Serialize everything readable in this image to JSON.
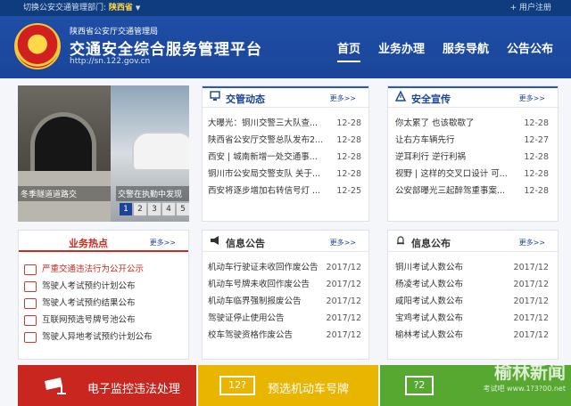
{
  "topbar": {
    "switch_label": "切换公安交通管理部门:",
    "province": "陕西省",
    "register": "用户注册"
  },
  "header": {
    "org": "陕西省公安厅交通管理局",
    "title": "交通安全综合服务管理平台",
    "url": "http://sn.122.gov.cn"
  },
  "nav": [
    "首页",
    "业务办理",
    "服务导航",
    "公告公布"
  ],
  "slider": {
    "caption1": "冬季隧道道路交",
    "caption2": "交警在执勤中发现",
    "pages": [
      "1",
      "2",
      "3",
      "4",
      "5"
    ]
  },
  "news": {
    "title": "交管动态",
    "more": "更多>>",
    "items": [
      {
        "t": "大曝光：铜川交警三大队查...",
        "d": "12-28"
      },
      {
        "t": "陕西省公安厅交警总队发布2...",
        "d": "12-28"
      },
      {
        "t": "西安 | 城南新增一处交通事...",
        "d": "12-28"
      },
      {
        "t": "铜川市公安局交警支队 关于...",
        "d": "12-28"
      },
      {
        "t": "西安将逐步增加右转信号灯 ...",
        "d": "12-25"
      }
    ]
  },
  "safety": {
    "title": "安全宣传",
    "more": "更多>>",
    "items": [
      {
        "t": "你太累了 也该歇歇了",
        "d": "12-28"
      },
      {
        "t": "让右方车辆先行",
        "d": "12-27"
      },
      {
        "t": "逆耳利行 逆行利祸",
        "d": "12-28"
      },
      {
        "t": "视野 | 这样的交叉口设计 可...",
        "d": "12-28"
      },
      {
        "t": "公安部曝光三起醉驾重事案...",
        "d": "12-28"
      }
    ]
  },
  "hot": {
    "title": "业务热点",
    "more": "更多>>",
    "items": [
      {
        "t": "严重交通违法行为公开公示",
        "red": true
      },
      {
        "t": "驾驶人考试预约计划公布",
        "red": false
      },
      {
        "t": "驾驶人考试预约结果公布",
        "red": false
      },
      {
        "t": "互联网预选号牌号池公布",
        "red": false
      },
      {
        "t": "驾驶人异地考试预约计划公布",
        "red": false
      }
    ]
  },
  "notice": {
    "title": "信息公告",
    "more": "更多>>",
    "items": [
      {
        "t": "机动车行驶证未收回作废公告",
        "d": "2017/12"
      },
      {
        "t": "机动车号牌未收回作废公告",
        "d": "2017/12"
      },
      {
        "t": "机动车临界强制报废公告",
        "d": "2017/12"
      },
      {
        "t": "驾驶证停止使用公告",
        "d": "2017/12"
      },
      {
        "t": "校车驾驶资格作废公告",
        "d": "2017/12"
      }
    ]
  },
  "publish": {
    "title": "信息公布",
    "more": "更多>>",
    "items": [
      {
        "t": "铜川考试人数公布",
        "d": "2017/12"
      },
      {
        "t": "杨凌考试人数公布",
        "d": "2017/12"
      },
      {
        "t": "咸阳考试人数公布",
        "d": "2017/12"
      },
      {
        "t": "宝鸡考试人数公布",
        "d": "2017/12"
      },
      {
        "t": "榆林考试人数公布",
        "d": "2017/12"
      }
    ]
  },
  "bottom": {
    "b1": "电子监控违法处理",
    "b2": "预选机动车号牌",
    "b2_icon_text": "12?",
    "b3_icon_text": "?2"
  },
  "watermark": {
    "main": "榆林新闻",
    "sub": "考试吧 www.1?3?00.net"
  },
  "colors": {
    "header_blue": "#1a4599",
    "red_button": "#c8261e",
    "yellow_button": "#e8b500",
    "green_button": "#56a830",
    "hot_red": "#cc2a1f"
  }
}
